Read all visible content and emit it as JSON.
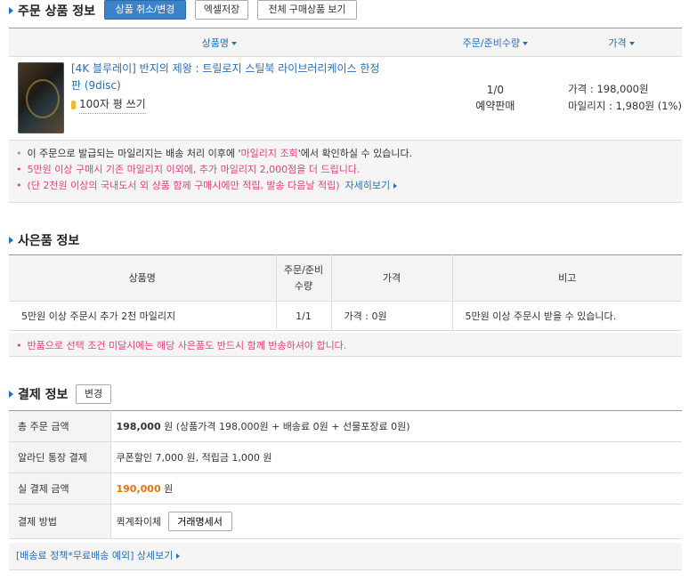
{
  "order": {
    "title": "주문 상품 정보",
    "buttons": {
      "cancel": "상품 취소/변경",
      "excel": "엑셀저장",
      "view_all": "전체 구매상품 보기"
    },
    "headers": {
      "product": "상품명",
      "qty": "주문/준비수량",
      "price": "가격"
    },
    "item": {
      "name_line1": "[4K 블루레이] 반지의 제왕 : 트릴로지 스틸북 라이브러리케이스 한정",
      "name_line2": "판 (9disc)",
      "review": "100자 평 쓰기",
      "qty": "1/0",
      "qty_status": "예약판매",
      "price": "가격 : 198,000원",
      "mileage": "마일리지 : 1,980원 (1%)"
    },
    "notices": {
      "n1_pre": "이 주문으로 발급되는 마일리지는 배송 처리 이후에 '",
      "n1_link": "마일리지 조회",
      "n1_post": "'에서 확인하실 수 있습니다.",
      "n2": "5만원 이상 구매시 기존 마일리지 이외에, 추가 마일리지 2,000점을 더 드립니다.",
      "n3": "(단 2천원 이상의 국내도서 외 상품 함께 구매시에만 적립, 발송 다음날 적립)",
      "n3_link": "자세히보기"
    }
  },
  "gift": {
    "title": "사은품 정보",
    "headers": {
      "name": "상품명",
      "qty_line1": "주문/준비",
      "qty_line2": "수량",
      "price": "가격",
      "note": "비고"
    },
    "row": {
      "name": "5만원 이상 주문시 추가 2천 마일리지",
      "qty": "1/1",
      "price": "가격 : 0원",
      "note": "5만원 이상 주문시 받을 수 있습니다."
    },
    "notice": "반품으로 선택 조건 미달시에는 해당 사은품도 반드시 함께 반송하셔야 합니다."
  },
  "payment": {
    "title": "결제 정보",
    "change_button": "변경",
    "rows": {
      "total_label": "총 주문 금액",
      "total_amount": "198,000",
      "total_detail": " 원 (상품가격 198,000원 + 배송료 0원 + 선물포장료 0원)",
      "discount_label": "알라딘 통장 결제",
      "discount_value": "쿠폰할인 7,000 원, 적립금 1,000 원",
      "actual_label": "실 결제 금액",
      "actual_amount": "190,000",
      "actual_unit": " 원",
      "method_label": "결제 방법",
      "method_value": "퀵계좌이체",
      "receipt_button": "거래명세서"
    },
    "footer_link": "[배송료 정책*무료배송 예외] 상세보기"
  },
  "colors": {
    "accent": "#2b6db3",
    "price_orange": "#e8730c",
    "notice_pink": "#e0447a"
  }
}
